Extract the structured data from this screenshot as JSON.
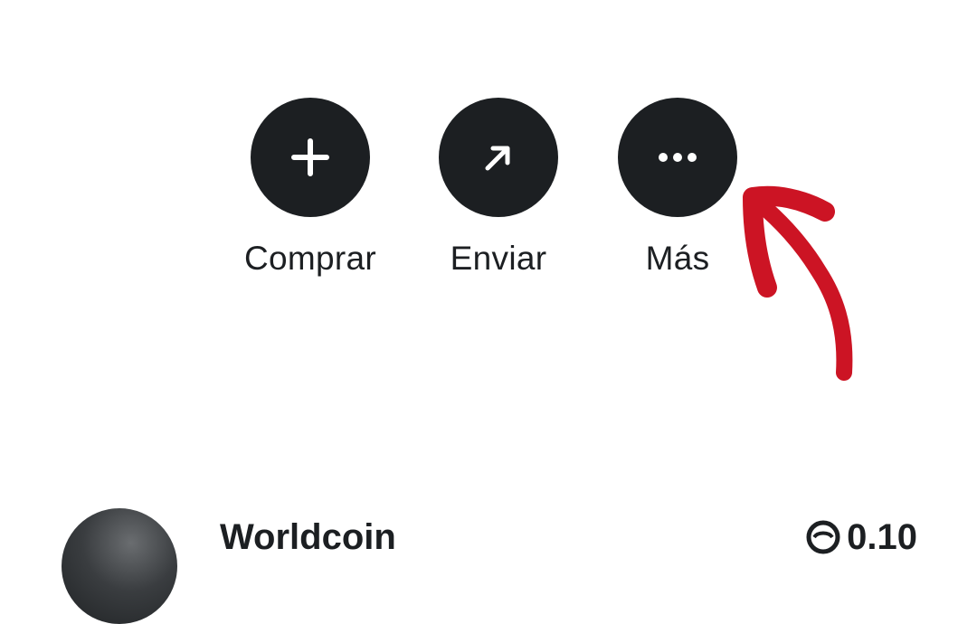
{
  "actions": [
    {
      "id": "buy",
      "label": "Comprar",
      "icon": "plus-icon"
    },
    {
      "id": "send",
      "label": "Enviar",
      "icon": "arrow-up-right-icon"
    },
    {
      "id": "more",
      "label": "Más",
      "icon": "more-horizontal-icon"
    }
  ],
  "annotation": {
    "icon": "red-arrow-annotation",
    "color": "#cc1424"
  },
  "token": {
    "name": "Worldcoin",
    "balance": "0.10",
    "currency_icon": "worldcoin-icon"
  },
  "colors": {
    "button_bg": "#1c1f22",
    "text": "#1c1f22",
    "background": "#ffffff"
  }
}
